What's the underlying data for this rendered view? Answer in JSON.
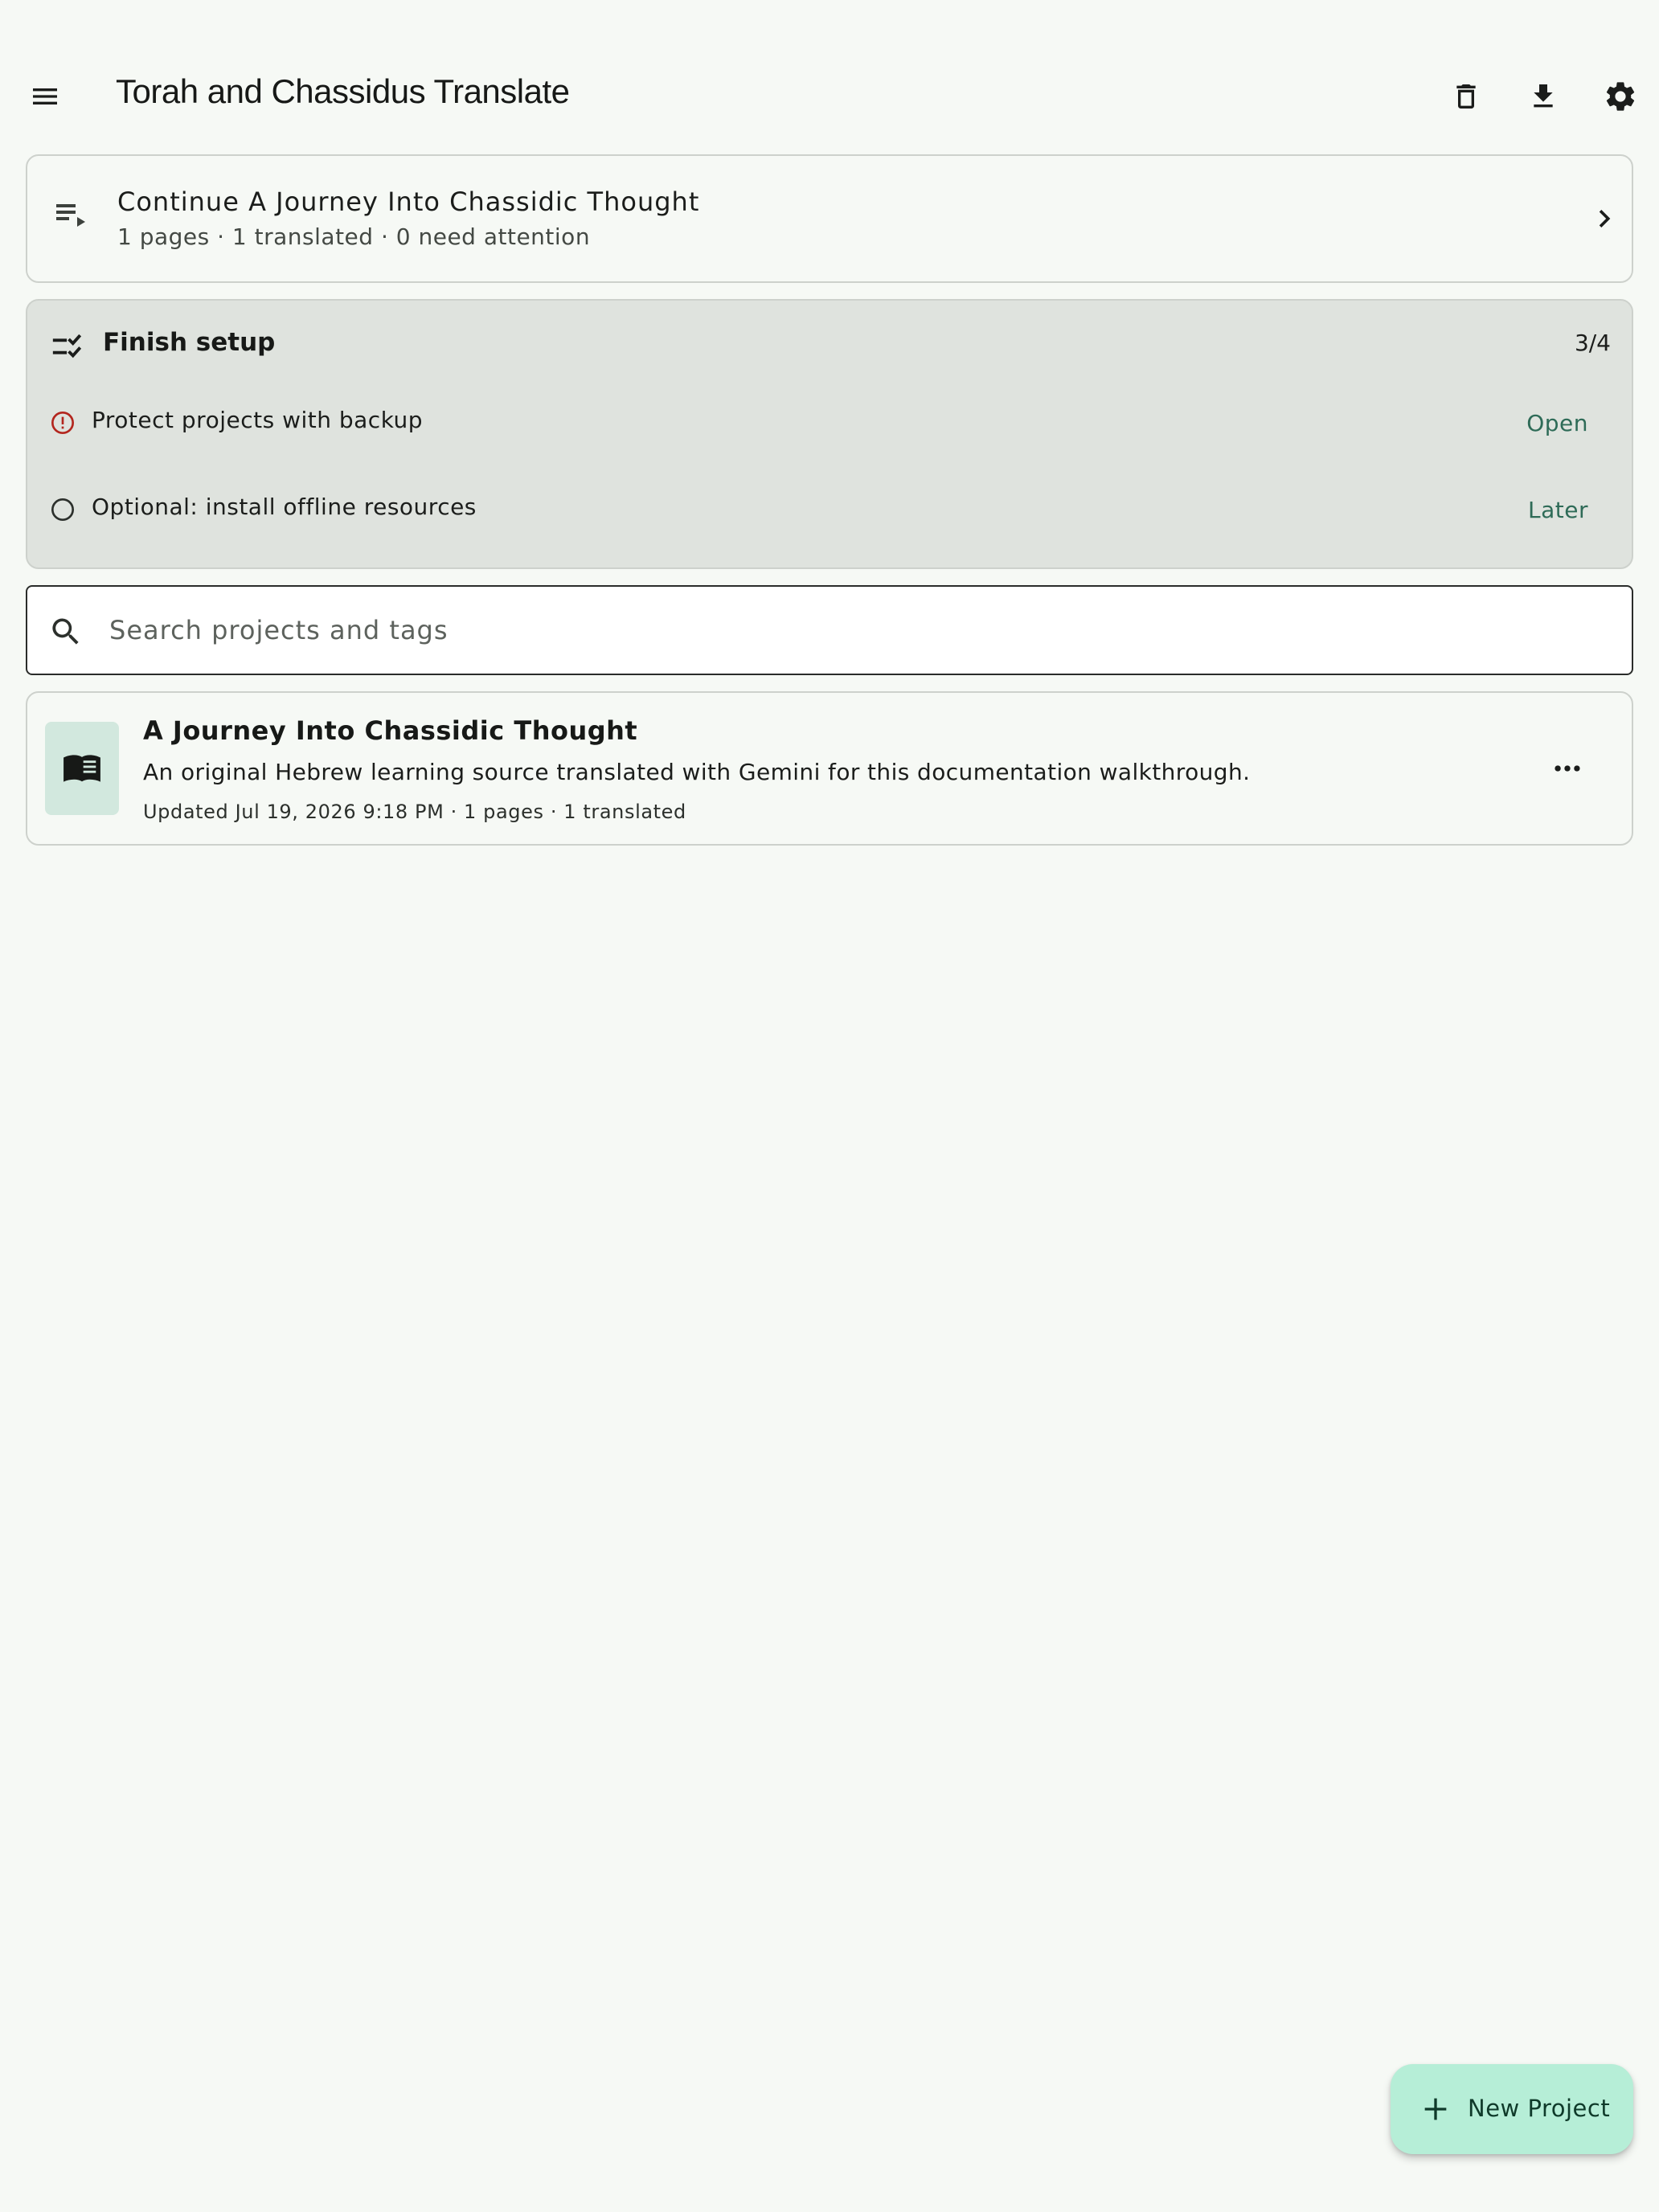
{
  "app_bar": {
    "title": "Torah and Chassidus Translate",
    "menu_icon": "menu-icon",
    "actions": [
      "trash-icon",
      "download-icon",
      "settings-icon"
    ]
  },
  "continue_card": {
    "icon": "playlist-play-icon",
    "title": "Continue A Journey Into Chassidic Thought",
    "subtitle": "1 pages · 1 translated · 0 need attention",
    "trailing_icon": "chevron-right-icon"
  },
  "setup": {
    "icon": "checklist-icon",
    "title": "Finish setup",
    "progress": "3/4",
    "items": [
      {
        "icon": "alert-circle-icon",
        "label": "Protect projects with backup",
        "action": "Open"
      },
      {
        "icon": "empty-circle-icon",
        "label": "Optional: install offline resources",
        "action": "Later"
      }
    ]
  },
  "search": {
    "icon": "search-icon",
    "placeholder": "Search projects and tags",
    "value": ""
  },
  "projects": [
    {
      "icon": "book-icon",
      "title": "A Journey Into Chassidic Thought",
      "description": "An original Hebrew learning source translated with Gemini for this documentation walkthrough.",
      "meta": "Updated Jul 19, 2026 9:18 PM · 1 pages · 1 translated",
      "menu_icon": "more-horizontal-icon"
    }
  ],
  "fab": {
    "icon": "plus-icon",
    "label": "New Project"
  },
  "colors": {
    "background": "#f6f9f5",
    "setup_card": "#dfe3de",
    "accent_text": "#2e6b57",
    "warning": "#b3261e",
    "fab": "#b6eed7",
    "thumb": "#d2e8de"
  }
}
